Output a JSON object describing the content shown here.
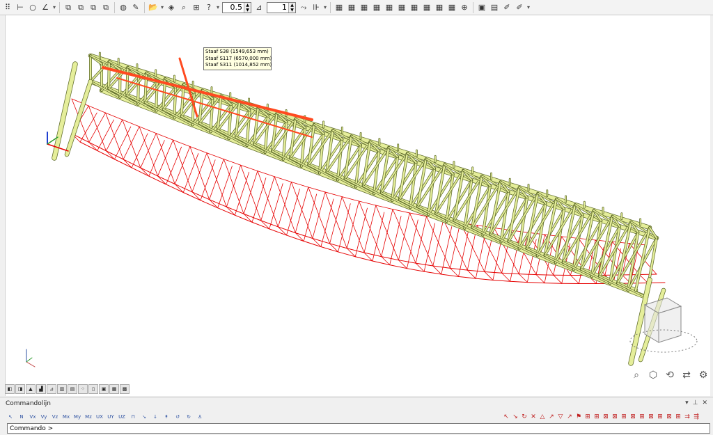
{
  "toolbar": {
    "scale_value": "0.5",
    "step_value": "1"
  },
  "tooltip": {
    "lines": [
      "Staaf S38 (1549,653 mm)",
      "Staaf S117 (6570,000 mm)",
      "Staaf S311 (1014,852 mm)"
    ]
  },
  "axes": {
    "x": "x",
    "y": "y",
    "z": "z"
  },
  "command_panel": {
    "title": "Commandolijn",
    "prompt": "Commando >"
  },
  "colors": {
    "structure": "#e5ee9a",
    "structure_edge": "#5e6b2a",
    "deformed": "#e60000",
    "selected": "#ff4a20"
  },
  "icons": [
    "select-icon",
    "node-icon",
    "line-icon",
    "support-icon",
    "load-icon",
    "nav-cube-icon",
    "zoom-icon",
    "rotate-icon"
  ]
}
